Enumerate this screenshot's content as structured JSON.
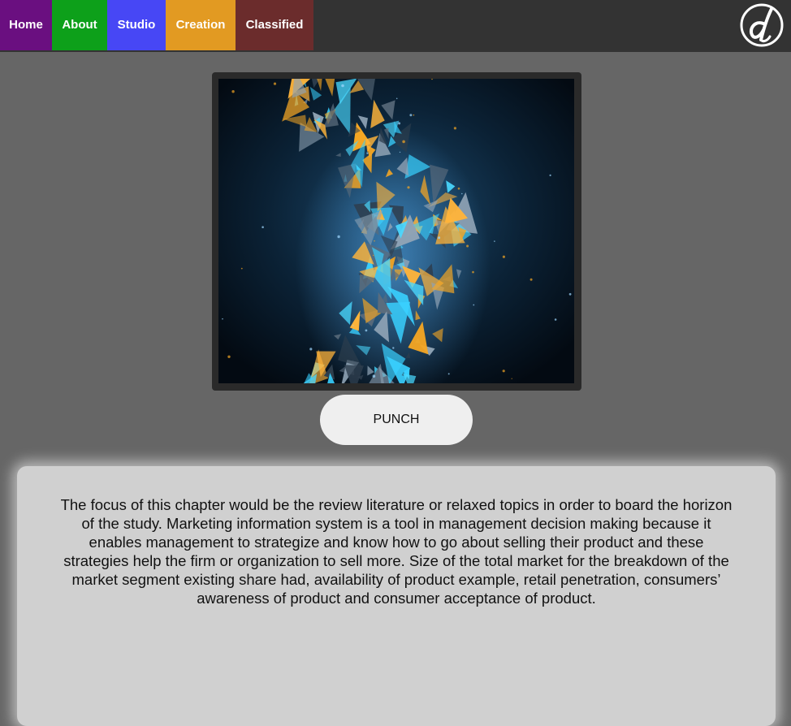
{
  "nav": {
    "items": [
      {
        "label": "Home",
        "color": "#6a0f80"
      },
      {
        "label": "About",
        "color": "#0da01a"
      },
      {
        "label": "Studio",
        "color": "#4747f5"
      },
      {
        "label": "Creation",
        "color": "#e29a22"
      },
      {
        "label": "Classified",
        "color": "#6b2c2c"
      }
    ],
    "logo_icon": "script-d-logo-icon"
  },
  "media": {
    "icon": "abstract-shattered-shards-image"
  },
  "punch_button": {
    "label": "PUNCH"
  },
  "content": {
    "text": "The focus of this chapter would be the review literature or relaxed topics in order to board the horizon of the study. Marketing information system is a tool in management decision making because it enables management to strategize and know how to go about selling their product and these strategies help the firm or organization to sell more. Size of the total market for the breakdown of the market segment existing share had, availability of product example, retail penetration, consumers’ awareness of product and consumer acceptance of product."
  }
}
